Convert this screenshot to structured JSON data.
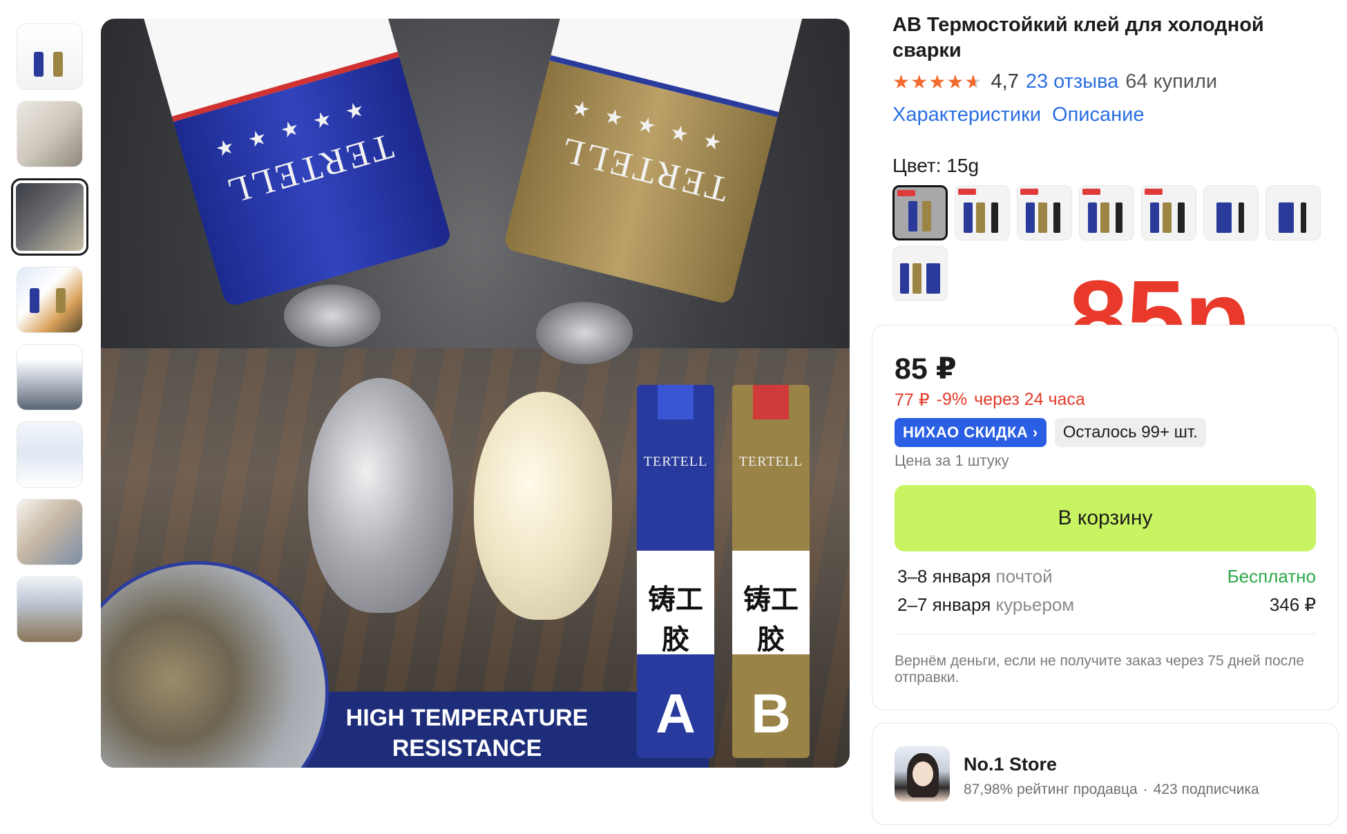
{
  "product": {
    "title": "АВ Термостойкий клей для холодной сварки",
    "rating_value": "4,7",
    "reviews_label": "23 отзыва",
    "bought_label": "64 купили",
    "rating_stars": 4.7
  },
  "links": {
    "characteristics": "Характеристики",
    "description": "Описание"
  },
  "color": {
    "label": "Цвет: 15g",
    "selected_index": 0
  },
  "image": {
    "tube_brand": "TERTELL",
    "tube_cjk": "铸工胶",
    "tube_a": "A",
    "tube_b": "B",
    "caption_line1": "HIGH TEMPERATURE",
    "caption_line2": "RESISTANCE"
  },
  "overlay": {
    "big_price": "85р",
    "color": "#e8392a"
  },
  "price_card": {
    "price": "85 ₽",
    "discount_price": "77 ₽",
    "discount_pct": "-9%",
    "discount_time": "через 24 часа",
    "badge_promo": "НИХАО СКИДКА ›",
    "badge_stock": "Осталось 99+ шт.",
    "unit_note": "Цена за 1 штуку",
    "cart_button": "В корзину",
    "delivery": [
      {
        "date": "3–8 января",
        "method": "почтой",
        "price": "Бесплатно"
      },
      {
        "date": "2–7 января",
        "method": "курьером",
        "price": "346 ₽"
      }
    ],
    "refund_note": "Вернём деньги, если не получите заказ через 75 дней после отправки."
  },
  "store": {
    "name": "No.1 Store",
    "rating": "87,98% рейтинг продавца",
    "subscribers": "423 подписчика"
  },
  "colors": {
    "accent_green": "#c8f461",
    "link_blue": "#2a6fe0",
    "discount_red": "#e33b2a",
    "star_orange": "#f26a2e",
    "badge_blue": "#2a5fe3"
  }
}
